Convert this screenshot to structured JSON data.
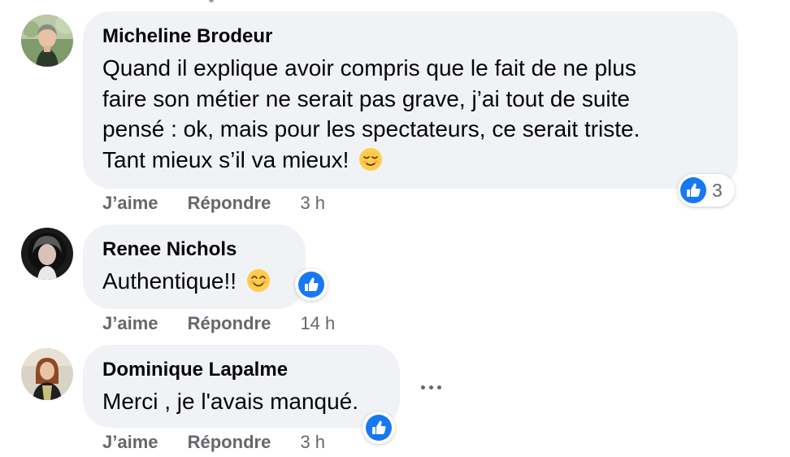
{
  "comments": [
    {
      "author": "Micheline Brodeur",
      "lines": [
        "Quand il explique avoir compris que le fait de ne plus",
        "faire son métier ne serait pas grave, j’ai tout de suite",
        "pensé : ok, mais pour les spectateurs, ce serait triste.",
        "Tant mieux s’il va mieux!"
      ],
      "emoji": "relieved-face-icon",
      "like_label": "J’aime",
      "reply_label": "Répondre",
      "time": "3 h",
      "reaction_count": "3"
    },
    {
      "author": "Renee Nichols",
      "lines": [
        "Authentique!!"
      ],
      "emoji": "smiling-face-icon",
      "like_label": "J’aime",
      "reply_label": "Répondre",
      "time": "14 h"
    },
    {
      "author": "Dominique Lapalme",
      "lines": [
        "Merci , je l'avais manqué."
      ],
      "like_label": "J’aime",
      "reply_label": "Répondre",
      "time": "3 h"
    }
  ],
  "colors": {
    "bubble": "#f0f2f5",
    "like_blue": "#1877f2",
    "secondary_text": "#65676b"
  }
}
